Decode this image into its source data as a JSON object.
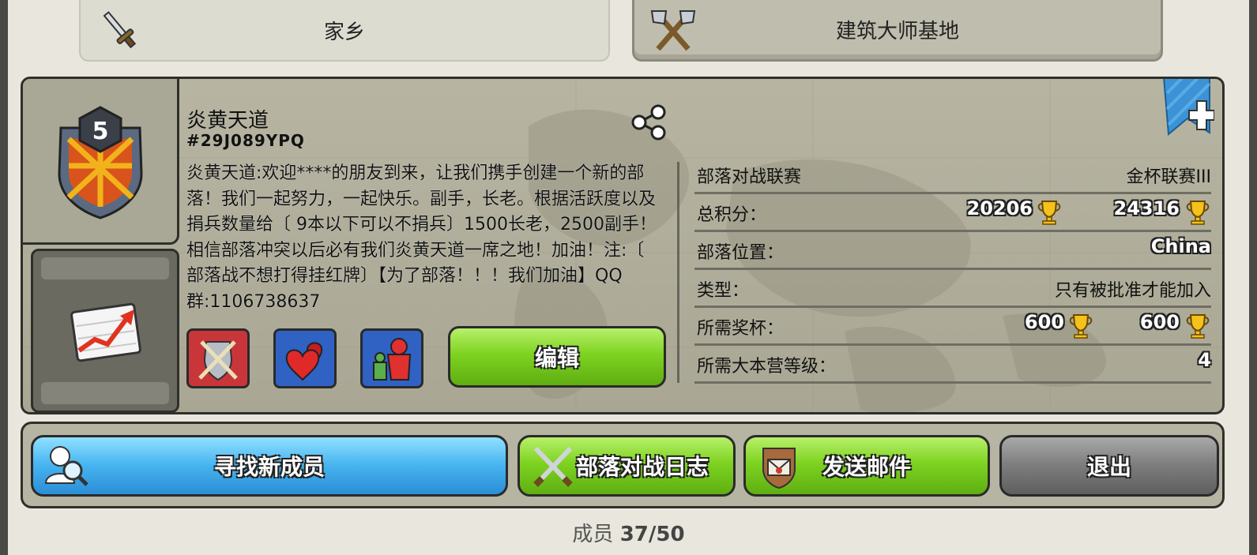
{
  "tabs": {
    "home": "家乡",
    "builder_base": "建筑大师基地"
  },
  "clan": {
    "level": "5",
    "name": "炎黄天道",
    "tag": "#29J089YPQ",
    "description": "炎黄天道:欢迎****的朋友到来，让我们携手创建一个新的部落！我们一起努力，一起快乐。副手，长老。根据活跃度以及捐兵数量给〔 9本以下可以不捐兵〕1500长老，2500副手！相信部落冲突以后必有我们炎黄天道一席之地！加油！注:〔 部落战不想打得挂红牌〕【为了部落！！！我们加油】QQ群:1106738637",
    "edit_label": "编辑"
  },
  "info": {
    "war_league_label": "部落对战联赛",
    "war_league_value": "金杯联赛III",
    "total_points_label": "总积分：",
    "total_points_1": "20206",
    "total_points_2": "24316",
    "location_label": "部落位置：",
    "location_value": "China",
    "type_label": "类型：",
    "type_value": "只有被批准才能加入",
    "required_trophies_label": "所需奖杯：",
    "required_trophies_1": "600",
    "required_trophies_2": "600",
    "required_th_label": "所需大本营等级：",
    "required_th_value": "4"
  },
  "actions": {
    "find_members": "寻找新成员",
    "war_log": "部落对战日志",
    "send_mail": "发送邮件",
    "leave": "退出"
  },
  "members": {
    "label": "成员",
    "count": "37/50"
  },
  "colors": {
    "green_button": "#7ed321",
    "blue_button": "#46b3ef",
    "gray_button": "#7c7c7c",
    "panel": "#b7b5a2"
  }
}
